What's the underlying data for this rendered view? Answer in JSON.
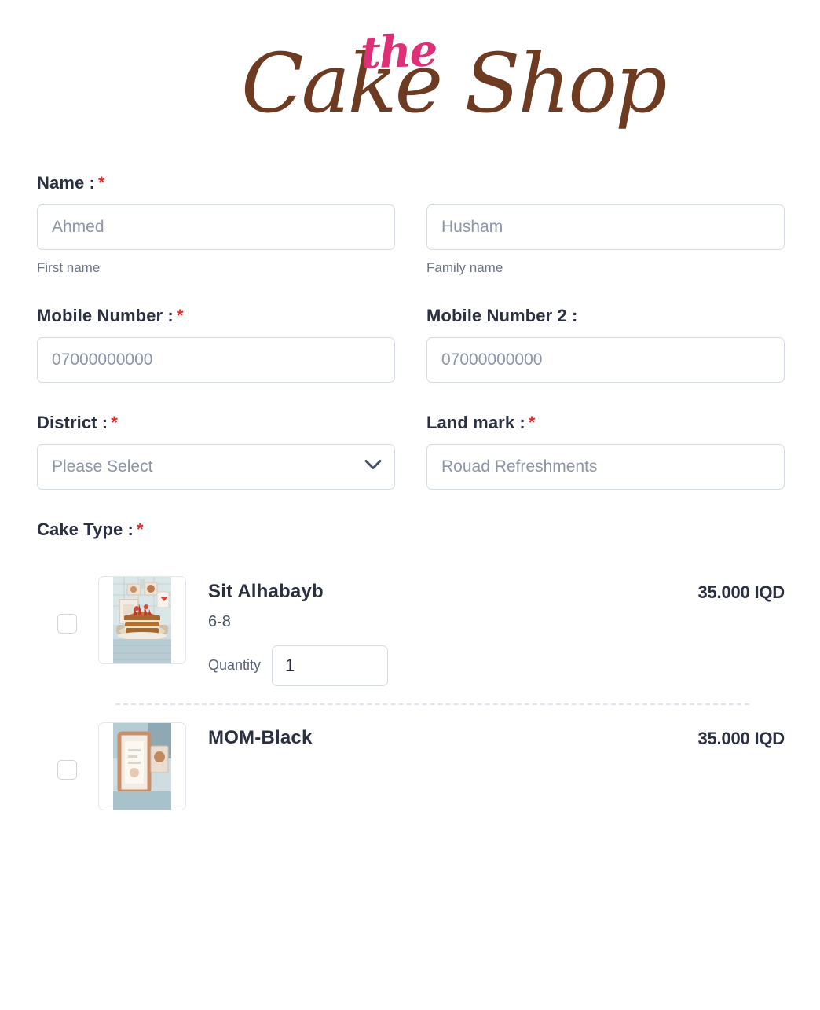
{
  "brand": {
    "the": "the",
    "name": "Cake Shop",
    "pink": "#dd3077",
    "brown": "#6d3b22"
  },
  "form": {
    "name": {
      "label": "Name :",
      "required": "*",
      "first": {
        "placeholder": "Ahmed",
        "hint": "First name"
      },
      "family": {
        "placeholder": "Husham",
        "hint": "Family name"
      }
    },
    "mobile": {
      "label": "Mobile Number :",
      "required": "*",
      "placeholder": "07000000000"
    },
    "mobile2": {
      "label": "Mobile Number 2 :",
      "required": "",
      "placeholder": "07000000000"
    },
    "district": {
      "label": "District :",
      "required": "*",
      "selected": "Please Select",
      "icon": "chevron-down-icon"
    },
    "landmark": {
      "label": "Land mark :",
      "required": "*",
      "placeholder": "Rouad Refreshments"
    },
    "cake_type": {
      "label": "Cake Type :",
      "required": "*",
      "quantity_label": "Quantity",
      "items": [
        {
          "title": "Sit Alhabayb",
          "size": "6-8",
          "price": "35.000 IQD",
          "quantity": "1",
          "checked": false,
          "image": "layered-cake-photo"
        },
        {
          "title": "MOM-Black",
          "size": "",
          "price": "35.000 IQD",
          "quantity": "",
          "checked": false,
          "image": "framed-cake-photo"
        }
      ]
    }
  }
}
